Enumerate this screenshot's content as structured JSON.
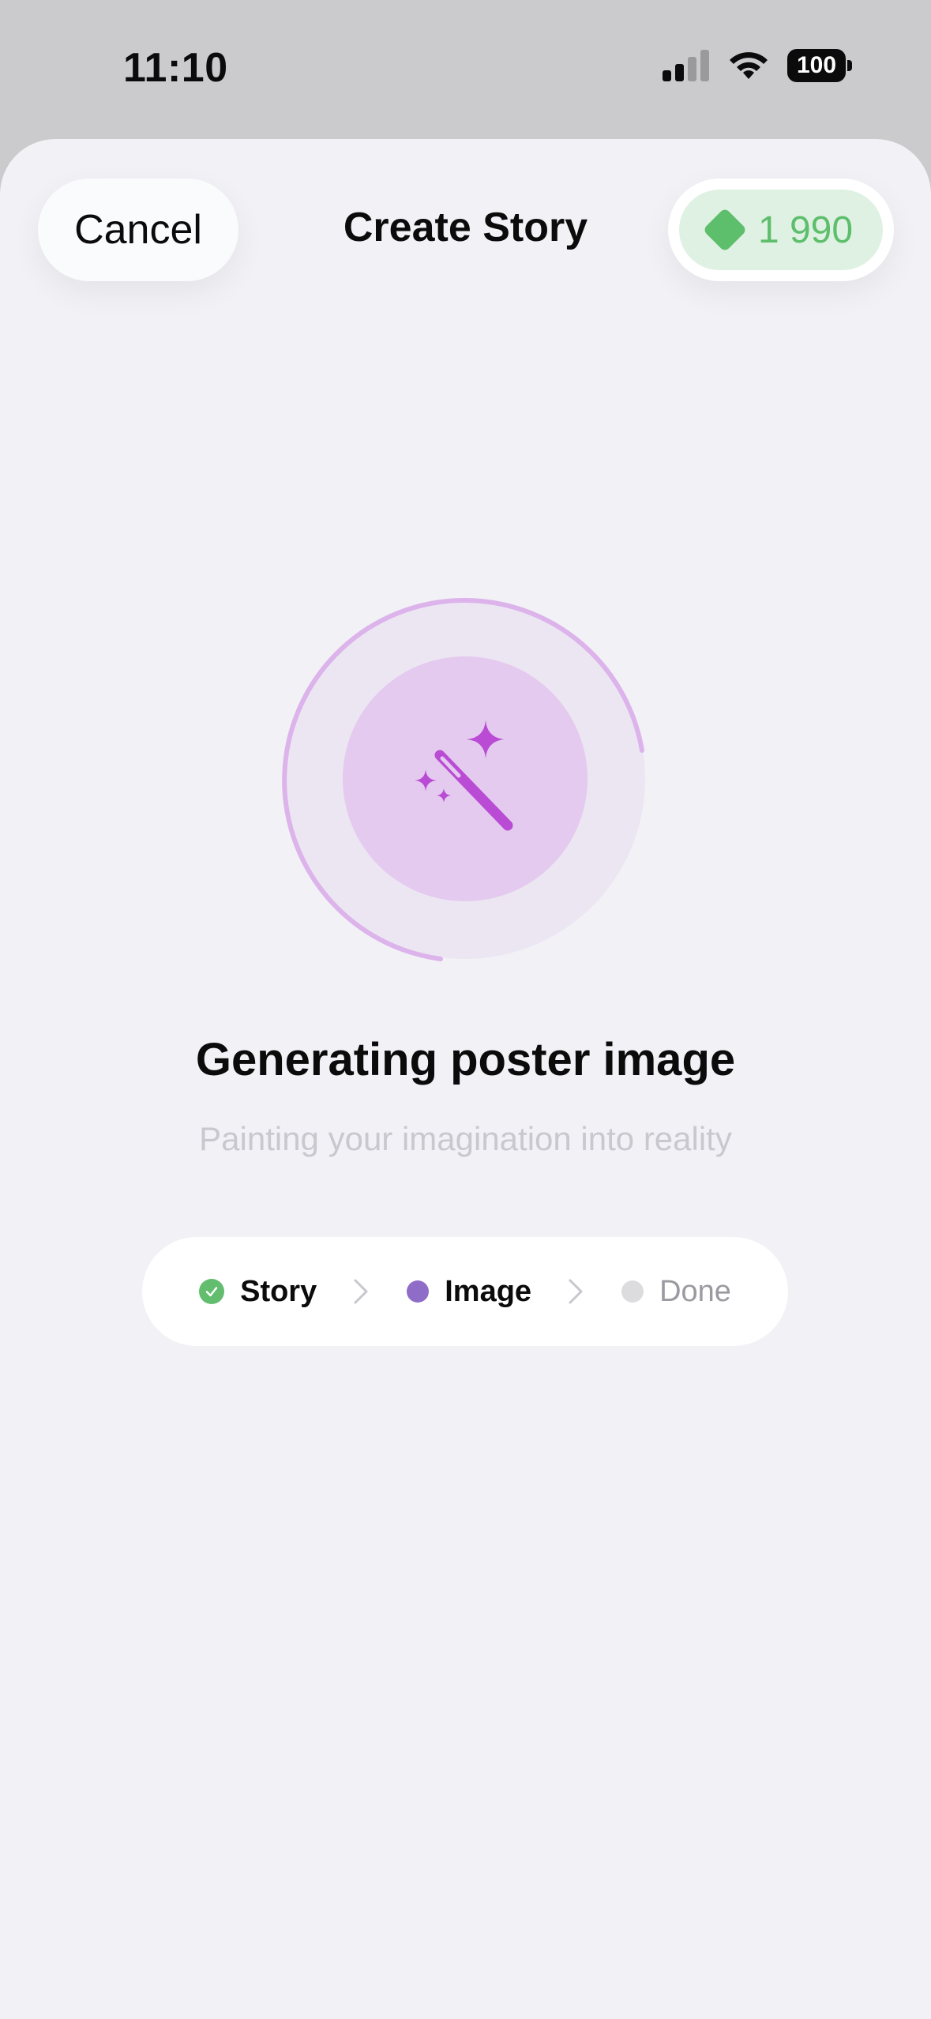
{
  "status_bar": {
    "time": "11:10",
    "battery": "100",
    "icons": [
      "signal-icon",
      "wifi-icon",
      "battery-icon"
    ]
  },
  "header": {
    "cancel_label": "Cancel",
    "title": "Create Story",
    "credits_icon": "gem-icon",
    "credits_value": "1 990"
  },
  "main": {
    "progress_icon": "magic-wand-icon",
    "title": "Generating poster image",
    "subtitle": "Painting your imagination into reality"
  },
  "steps": [
    {
      "label": "Story",
      "state": "done"
    },
    {
      "label": "Image",
      "state": "active"
    },
    {
      "label": "Done",
      "state": "pending"
    }
  ],
  "colors": {
    "accent_purple": "#b04ad6",
    "success_green": "#5dbe6b",
    "active_step": "#8e6cc8"
  }
}
